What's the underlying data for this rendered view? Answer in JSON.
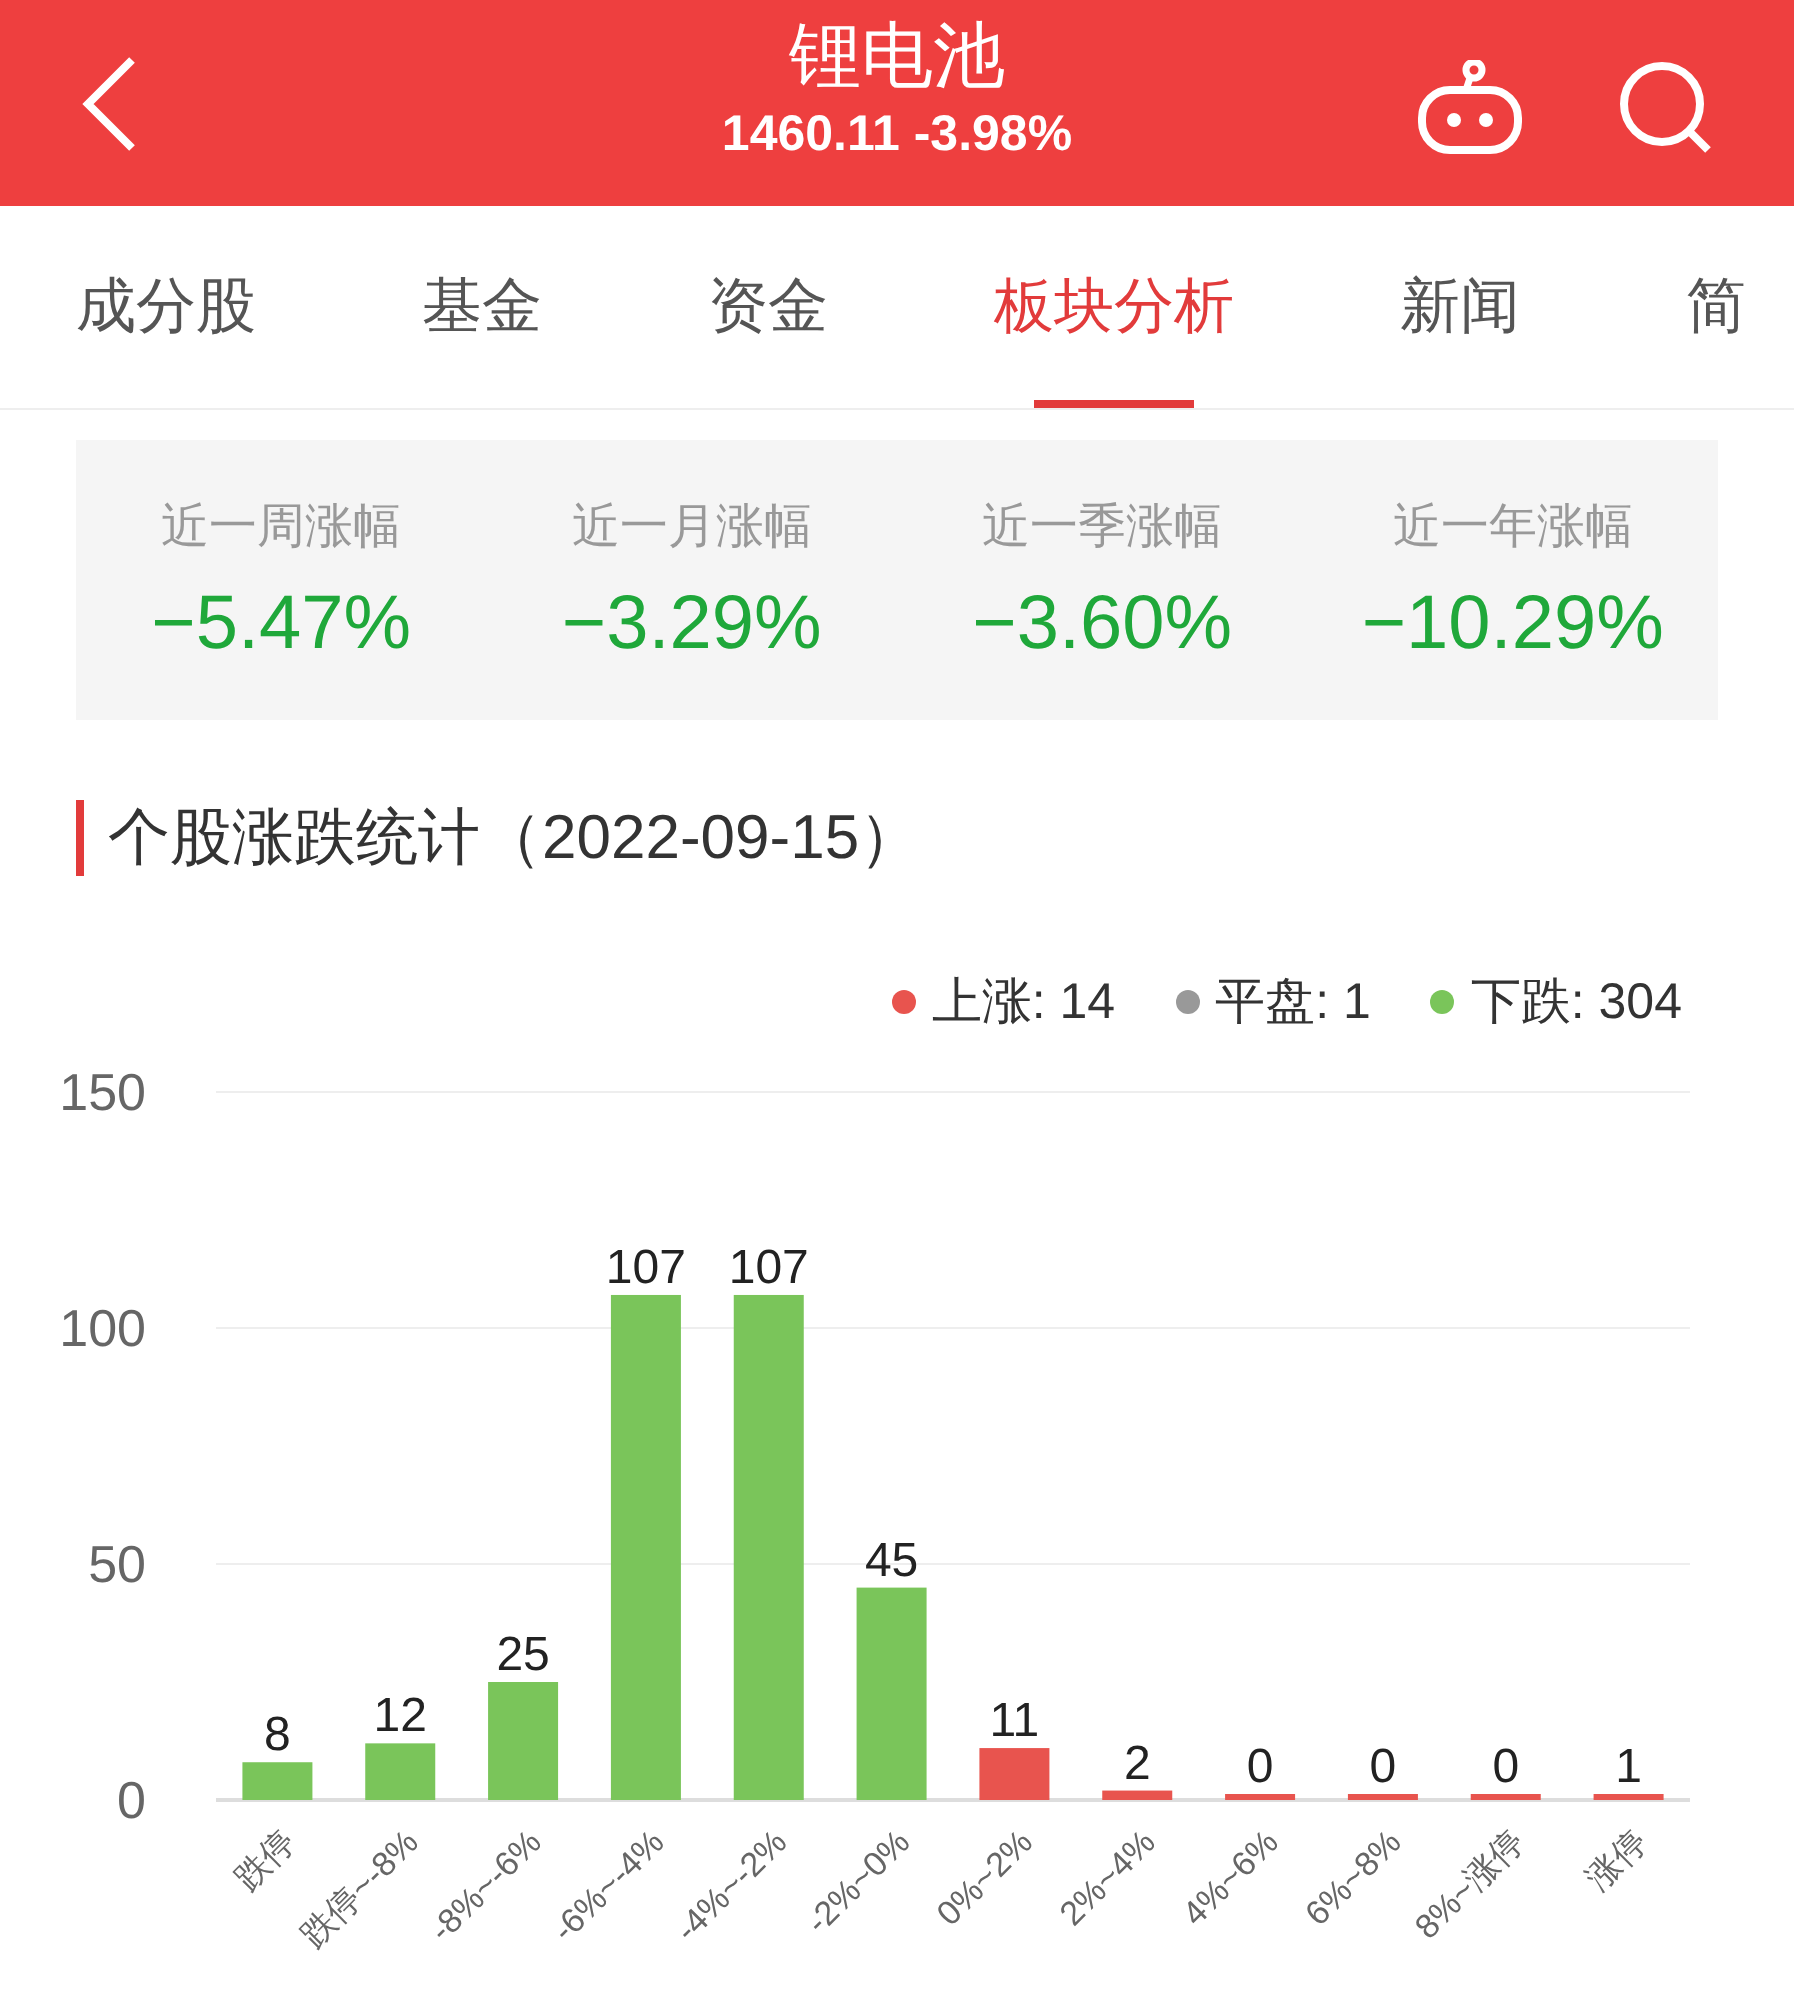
{
  "header": {
    "title": "锂电池",
    "subtitle": "1460.11 -3.98%"
  },
  "tabs": [
    {
      "label": "成分股",
      "selected": false
    },
    {
      "label": "基金",
      "selected": false
    },
    {
      "label": "资金",
      "selected": false
    },
    {
      "label": "板块分析",
      "selected": true
    },
    {
      "label": "新闻",
      "selected": false
    },
    {
      "label": "简",
      "selected": false
    }
  ],
  "stats": [
    {
      "label": "近一周涨幅",
      "value": "−5.47%"
    },
    {
      "label": "近一月涨幅",
      "value": "−3.29%"
    },
    {
      "label": "近一季涨幅",
      "value": "−3.60%"
    },
    {
      "label": "近一年涨幅",
      "value": "−10.29%"
    }
  ],
  "section_title": "个股涨跌统计（2022-09-15）",
  "legend": [
    {
      "label": "上涨: 14",
      "color": "#e8544e"
    },
    {
      "label": "平盘: 1",
      "color": "#999999"
    },
    {
      "label": "下跌: 304",
      "color": "#7ac55a"
    }
  ],
  "chart_data": {
    "type": "bar",
    "categories": [
      "跌停",
      "跌停~-8%",
      "-8%~-6%",
      "-6%~-4%",
      "-4%~-2%",
      "-2%~0%",
      "0%~2%",
      "2%~4%",
      "4%~6%",
      "6%~8%",
      "8%~涨停",
      "涨停"
    ],
    "series": [
      {
        "color": "#7ac55a",
        "values": [
          8,
          12,
          25,
          107,
          107,
          45,
          null,
          null,
          null,
          null,
          null,
          null
        ]
      },
      {
        "color": "#e8544e",
        "values": [
          null,
          null,
          null,
          null,
          null,
          null,
          11,
          2,
          0,
          0,
          0,
          1
        ]
      }
    ],
    "ylim": [
      0,
      150
    ],
    "yticks": [
      0,
      50,
      100,
      150
    ],
    "data_labels": true
  }
}
